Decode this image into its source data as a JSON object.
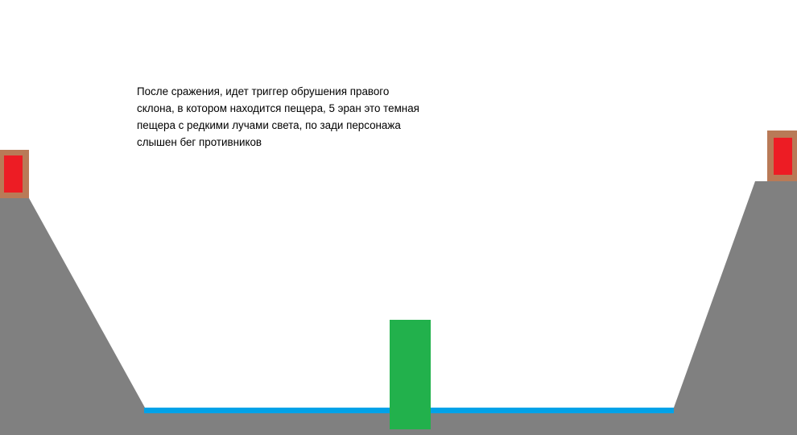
{
  "note": "После сражения, идет триггер обрушения правого\nсклона, в котором находится пещера, 5 эран это темная\nпещера с редкими лучами света, по зади персонажа\nслышен бег противников",
  "colors": {
    "background": "#ffffff",
    "ground": "#808080",
    "water": "#00a2e8",
    "player": "#22b14c",
    "door_frame": "#b97a57",
    "door": "#ed1c24",
    "text": "#000000"
  },
  "scene": {
    "ground": "grey-valley",
    "water": "blue-water-strip",
    "player": "green-character",
    "left_door": "red-door",
    "right_door": "red-door"
  }
}
